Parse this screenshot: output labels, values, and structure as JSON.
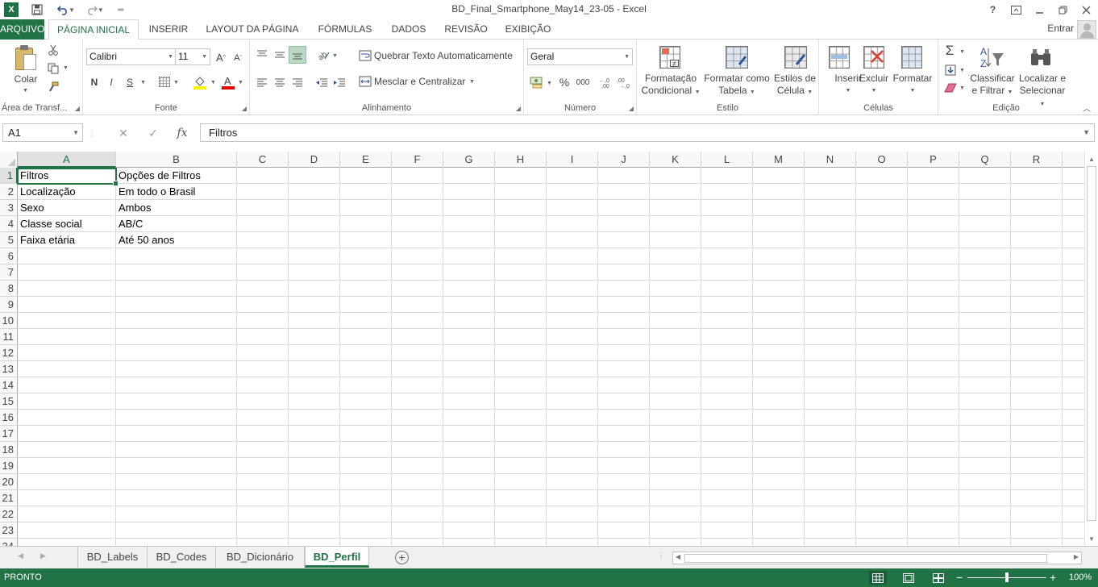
{
  "app": {
    "title": "BD_Final_Smartphone_May14_23-05 - Excel",
    "logo": "X",
    "signin": "Entrar"
  },
  "ribbon_tabs": [
    "ARQUIVO",
    "PÁGINA INICIAL",
    "INSERIR",
    "LAYOUT DA PÁGINA",
    "FÓRMULAS",
    "DADOS",
    "REVISÃO",
    "EXIBIÇÃO"
  ],
  "active_tab": "PÁGINA INICIAL",
  "ribbon": {
    "clipboard": {
      "paste": "Colar",
      "label": "Área de Transf..."
    },
    "font": {
      "name": "Calibri",
      "size": "11",
      "bold": "N",
      "italic": "I",
      "underline": "S",
      "label": "Fonte"
    },
    "alignment": {
      "wrap": "Quebrar Texto Automaticamente",
      "merge": "Mesclar e Centralizar",
      "label": "Alinhamento"
    },
    "number": {
      "format": "Geral",
      "percent": "%",
      "thousands": "000",
      "label": "Número"
    },
    "styles": {
      "conditional_1": "Formatação",
      "conditional_2": "Condicional",
      "table_1": "Formatar como",
      "table_2": "Tabela",
      "cell_1": "Estilos de",
      "cell_2": "Célula",
      "label": "Estilo"
    },
    "cells": {
      "insert": "Inserir",
      "delete": "Excluir",
      "format": "Formatar",
      "label": "Células"
    },
    "editing": {
      "sort_1": "Classificar",
      "sort_2": "e Filtrar",
      "find_1": "Localizar e",
      "find_2": "Selecionar",
      "label": "Edição"
    }
  },
  "formula_bar": {
    "name_box": "A1",
    "content": "Filtros",
    "fx": "fx"
  },
  "grid": {
    "columns": [
      "A",
      "B",
      "C",
      "D",
      "E",
      "F",
      "G",
      "H",
      "I",
      "J",
      "K",
      "L",
      "M",
      "N",
      "O",
      "P",
      "Q",
      "R"
    ],
    "rows": [
      "1",
      "2",
      "3",
      "4",
      "5",
      "6",
      "7",
      "8",
      "9",
      "10",
      "11",
      "12",
      "13",
      "14",
      "15",
      "16",
      "17",
      "18",
      "19",
      "20",
      "21",
      "22",
      "23",
      "24"
    ],
    "data": [
      [
        "Filtros",
        "Opções de Filtros"
      ],
      [
        "Localização",
        "Em todo o Brasil"
      ],
      [
        "Sexo",
        "Ambos"
      ],
      [
        "Classe social",
        "AB/C"
      ],
      [
        "Faixa etária",
        "Até 50 anos"
      ]
    ]
  },
  "sheets": [
    "BD_Labels",
    "BD_Codes",
    "BD_Dicionário",
    "BD_Perfil"
  ],
  "active_sheet": "BD_Perfil",
  "status": {
    "text": "PRONTO",
    "zoom": "100%"
  },
  "colors": {
    "accent": "#217346",
    "selected_header": "#e1e1e1"
  }
}
